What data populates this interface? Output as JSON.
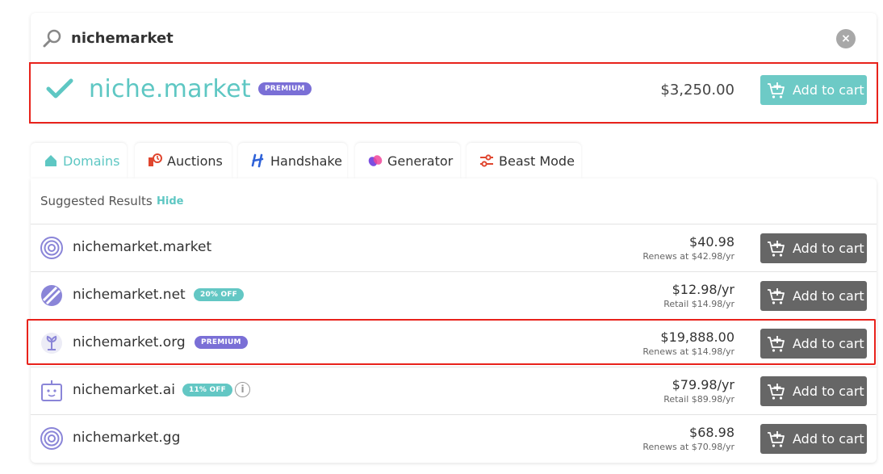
{
  "search": {
    "query": "nichemarket",
    "clear_label": "×"
  },
  "hero": {
    "domain": "niche.market",
    "badge": "PREMIUM",
    "price": "$3,250.00",
    "cart_label": "Add to cart"
  },
  "tabs": [
    {
      "label": "Domains",
      "icon": "home-icon"
    },
    {
      "label": "Auctions",
      "icon": "auction-icon"
    },
    {
      "label": "Handshake",
      "icon": "handshake-icon"
    },
    {
      "label": "Generator",
      "icon": "generator-icon"
    },
    {
      "label": "Beast Mode",
      "icon": "sliders-icon"
    }
  ],
  "results": {
    "header": "Suggested Results",
    "hide_label": "Hide",
    "rows": [
      {
        "domain": "nichemarket.market",
        "price": "$40.98",
        "sub": "Renews at $42.98/yr",
        "cart_label": "Add to cart",
        "icon": "target-icon"
      },
      {
        "domain": "nichemarket.net",
        "badge": "20% OFF",
        "price": "$12.98/yr",
        "sub": "Retail $14.98/yr",
        "cart_label": "Add to cart",
        "icon": "net-icon"
      },
      {
        "domain": "nichemarket.org",
        "badge": "PREMIUM",
        "price": "$19,888.00",
        "sub": "Renews at $14.98/yr",
        "cart_label": "Add to cart",
        "icon": "org-icon"
      },
      {
        "domain": "nichemarket.ai",
        "badge": "11% OFF",
        "price": "$79.98/yr",
        "sub": "Retail $89.98/yr",
        "cart_label": "Add to cart",
        "icon": "robot-icon",
        "info": "i"
      },
      {
        "domain": "nichemarket.gg",
        "price": "$68.98",
        "sub": "Renews at $70.98/yr",
        "cart_label": "Add to cart",
        "icon": "target-icon"
      }
    ]
  },
  "colors": {
    "teal": "#5ec7c3",
    "premium": "#7a6fd6",
    "highlight": "#e8221b",
    "cart_dark": "#666666"
  }
}
